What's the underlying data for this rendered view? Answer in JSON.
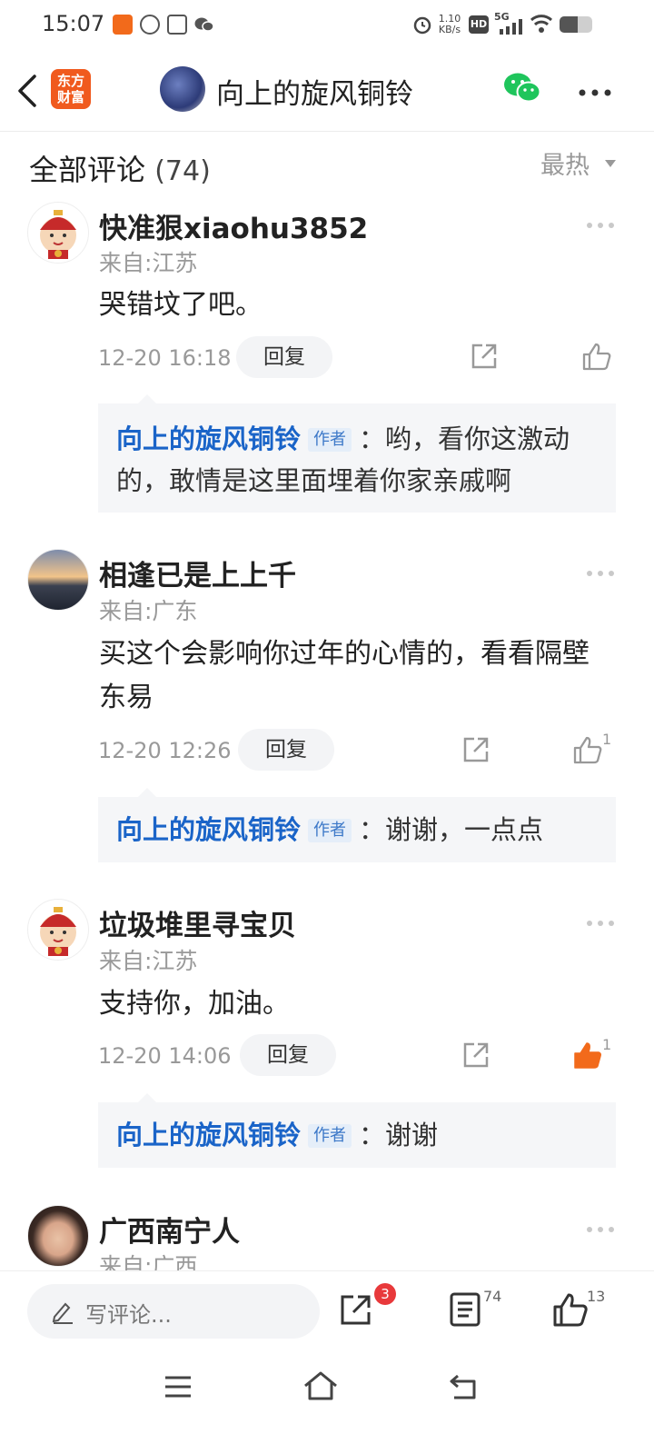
{
  "status_bar": {
    "time": "15:07",
    "net_speed_top": "1.10",
    "net_speed_unit": "KB/s",
    "net_type": "5G",
    "icons": [
      "alarm-icon",
      "hd-icon",
      "signal-icon",
      "wifi-icon",
      "battery-icon"
    ]
  },
  "header": {
    "back_icon": "back-arrow-icon",
    "logo_line1": "东方",
    "logo_line2": "财富",
    "title": "向上的旋风铜铃",
    "wechat_icon": "wechat-icon",
    "more_icon": "more-icon"
  },
  "section": {
    "title": "全部评论",
    "count": "(74)",
    "sort_label": "最热"
  },
  "comments": [
    {
      "username": "快准狠xiaohu3852",
      "location": "来自:江苏",
      "text": "哭错坟了吧。",
      "datetime": "12-20 16:18",
      "reply_label": "回复",
      "likes": "",
      "reply": {
        "author": "向上的旋风铜铃",
        "tag": "作者",
        "text": "：哟，看你这激动的，敢情是这里面埋着你家亲戚啊"
      }
    },
    {
      "username": "相逢已是上上千",
      "location": "来自:广东",
      "text": "买这个会影响你过年的心情的，看看隔壁东易",
      "datetime": "12-20 12:26",
      "reply_label": "回复",
      "likes": "1",
      "reply": {
        "author": "向上的旋风铜铃",
        "tag": "作者",
        "text": "：谢谢，一点点"
      }
    },
    {
      "username": "垃圾堆里寻宝贝",
      "location": "来自:江苏",
      "text": "支持你，加油。",
      "datetime": "12-20 14:06",
      "reply_label": "回复",
      "likes": "1",
      "liked": true,
      "reply": {
        "author": "向上的旋风铜铃",
        "tag": "作者",
        "text": "：谢谢"
      }
    },
    {
      "username": "广西南宁人",
      "location": "来自:广西"
    }
  ],
  "bottom_bar": {
    "input_placeholder": "写评论...",
    "share_badge": "3",
    "comment_count": "74",
    "like_count": "13"
  },
  "colors": {
    "accent_blue": "#1a64c8",
    "brand_orange": "#f05a1e",
    "liked_orange": "#f26a1b",
    "badge_red": "#e8393b"
  }
}
